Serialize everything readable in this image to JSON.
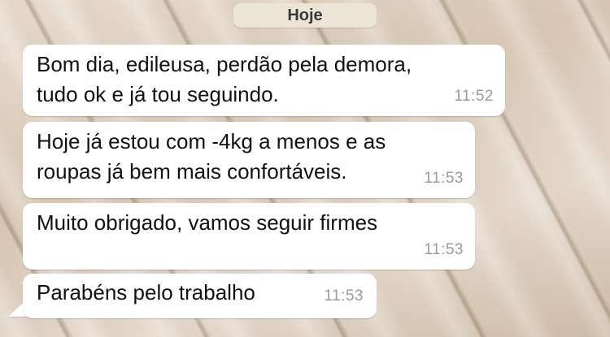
{
  "date_chip": "Hoje",
  "messages": [
    {
      "text": "Bom dia, edileusa, perdão pela demora,\ntudo ok e já tou seguindo.",
      "time": "11:52"
    },
    {
      "text": "Hoje já estou com -4kg a menos e as\nroupas já bem mais confortáveis.",
      "time": "11:53"
    },
    {
      "text": "Muito obrigado, vamos seguir firmes",
      "time": "11:53"
    },
    {
      "text": "Parabéns pelo trabalho",
      "time": "11:53"
    }
  ]
}
